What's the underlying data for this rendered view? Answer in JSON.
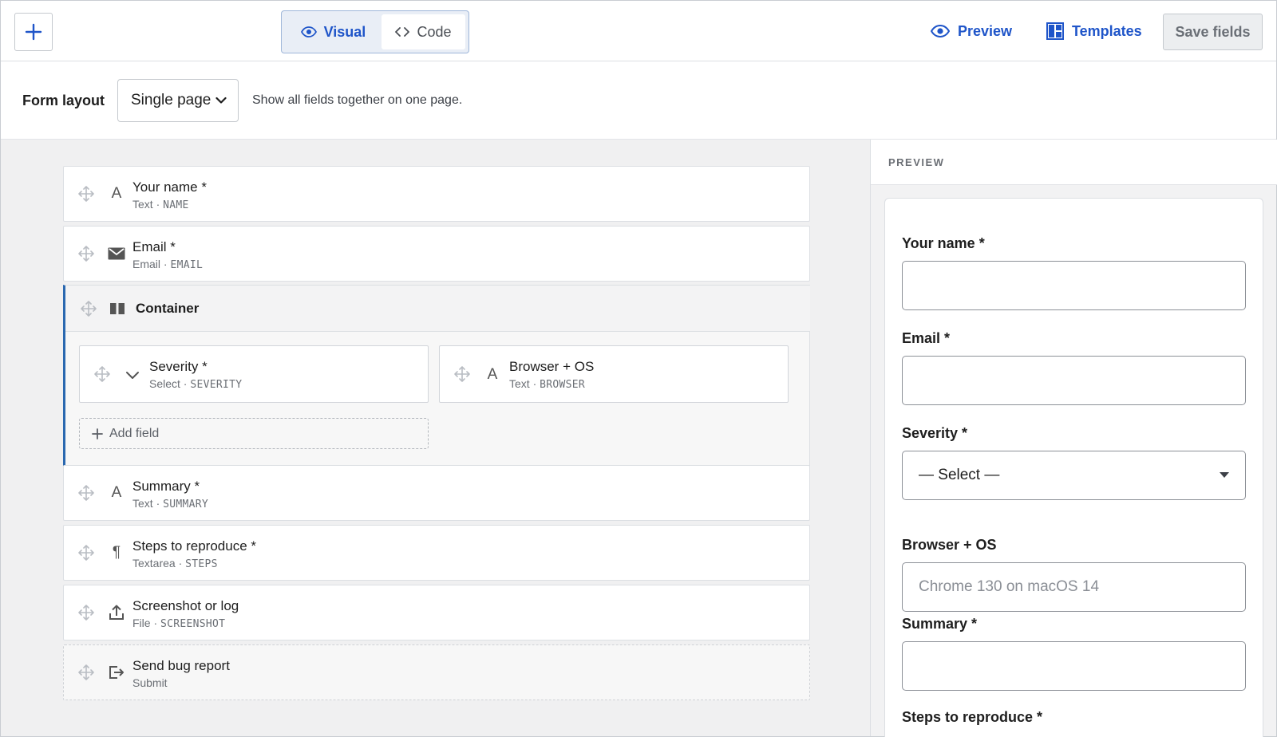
{
  "toolbar": {
    "add_label": "+",
    "mode_tabs": [
      {
        "label": "Visual",
        "icon": "eye-icon",
        "active": true
      },
      {
        "label": "Code",
        "icon": "code-icon",
        "active": false
      }
    ],
    "preview_label": "Preview",
    "templates_label": "Templates",
    "save_label": "Save fields",
    "accent_color": "#1f55c9"
  },
  "layout": {
    "label": "Form layout",
    "selected": "Single page",
    "help": "Show all fields together on one page."
  },
  "fields": [
    {
      "title": "Your name *",
      "type": "Text",
      "key": "NAME",
      "icon": "text-icon"
    },
    {
      "title": "Email *",
      "type": "Email",
      "key": "EMAIL",
      "icon": "envelope-icon"
    },
    {
      "title": "Summary *",
      "type": "Text",
      "key": "SUMMARY",
      "icon": "text-icon"
    },
    {
      "title": "Steps to reproduce *",
      "type": "Textarea",
      "key": "STEPS",
      "icon": "paragraph-icon"
    },
    {
      "title": "Screenshot or log",
      "type": "File",
      "key": "SCREENSHOT",
      "icon": "upload-icon"
    },
    {
      "title": "Send bug report",
      "type": "Submit",
      "icon": "submit-icon"
    }
  ],
  "container": {
    "title": "Container",
    "accent_color": "#2a68b0",
    "children": [
      {
        "title": "Severity *",
        "type": "Select",
        "key": "SEVERITY",
        "icon": "chevron-down-icon"
      },
      {
        "title": "Browser + OS",
        "type": "Text",
        "key": "BROWSER",
        "icon": "text-icon"
      }
    ],
    "add_field_label": "Add field"
  },
  "preview": {
    "header": "PREVIEW",
    "fields": [
      {
        "label": "Your name *",
        "value": ""
      },
      {
        "label": "Email *",
        "value": ""
      },
      {
        "label": "Severity *",
        "value": "— Select —"
      },
      {
        "label": "Browser + OS",
        "placeholder": "Chrome 130 on macOS 14"
      },
      {
        "label": "Summary *",
        "value": ""
      },
      {
        "label": "Steps to reproduce *"
      }
    ]
  }
}
